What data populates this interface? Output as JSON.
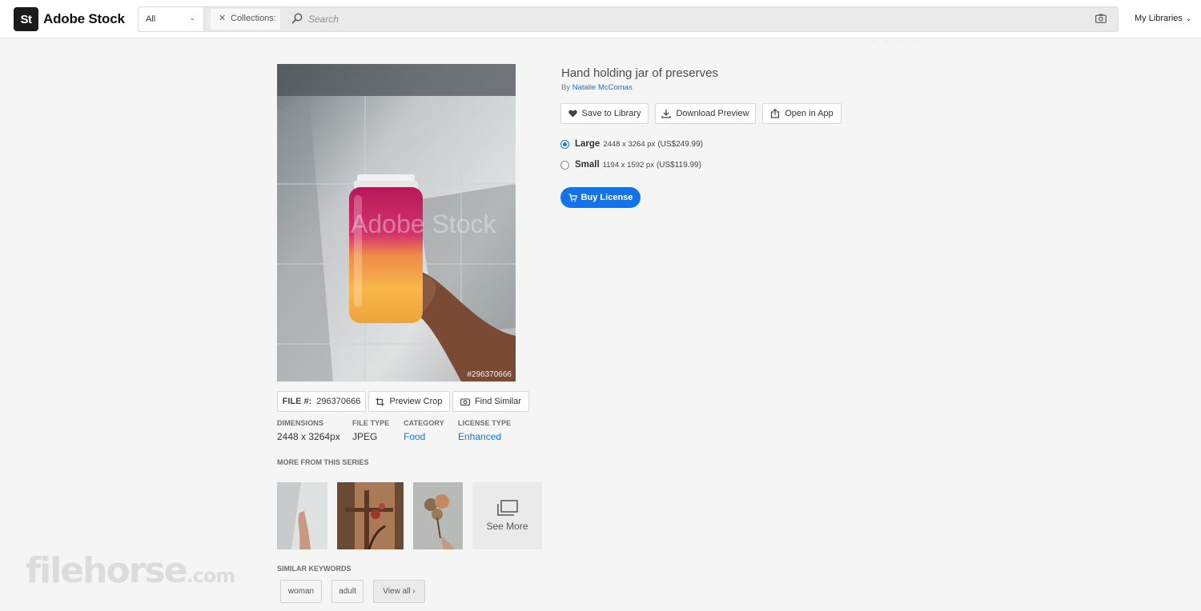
{
  "header": {
    "logo_badge": "St",
    "logo_text": "Adobe Stock",
    "type_select": "All",
    "collections_chip": "Collections:",
    "search_placeholder": "Search",
    "my_libraries": "My Libraries"
  },
  "asset": {
    "title": "Hand holding jar of preserves",
    "by_prefix": "By",
    "author": "Natalie McComas",
    "image_watermark": "Adobe Stock",
    "file_overlay": "#296370666",
    "file_label": "FILE #:",
    "file_number": "296370666"
  },
  "actions": {
    "save_to_library": "Save to Library",
    "download_preview": "Download Preview",
    "open_in_app": "Open in App",
    "preview_crop": "Preview Crop",
    "find_similar": "Find Similar",
    "buy_license": "Buy License"
  },
  "sizes": [
    {
      "name": "Large",
      "dims": "2448 x 3264 px",
      "price": "(US$249.99)",
      "selected": true
    },
    {
      "name": "Small",
      "dims": "1194 x 1592 px",
      "price": "(US$119.99)",
      "selected": false
    }
  ],
  "meta": [
    {
      "label": "DIMENSIONS",
      "value": "2448 x 3264px",
      "link": false
    },
    {
      "label": "FILE TYPE",
      "value": "JPEG",
      "link": false
    },
    {
      "label": "CATEGORY",
      "value": "Food",
      "link": true
    },
    {
      "label": "LICENSE TYPE",
      "value": "Enhanced",
      "link": true
    }
  ],
  "series": {
    "label": "MORE FROM THIS SERIES",
    "see_more": "See More"
  },
  "keywords": {
    "label": "SIMILAR KEYWORDS",
    "items": [
      "woman",
      "adult"
    ],
    "view_all": "View all ›"
  },
  "colors": {
    "accent": "#1473e6",
    "text": "#2c2c2c",
    "background": "#f5f5f5"
  },
  "watermark": {
    "main": "filehorse",
    "suffix": ".com"
  }
}
